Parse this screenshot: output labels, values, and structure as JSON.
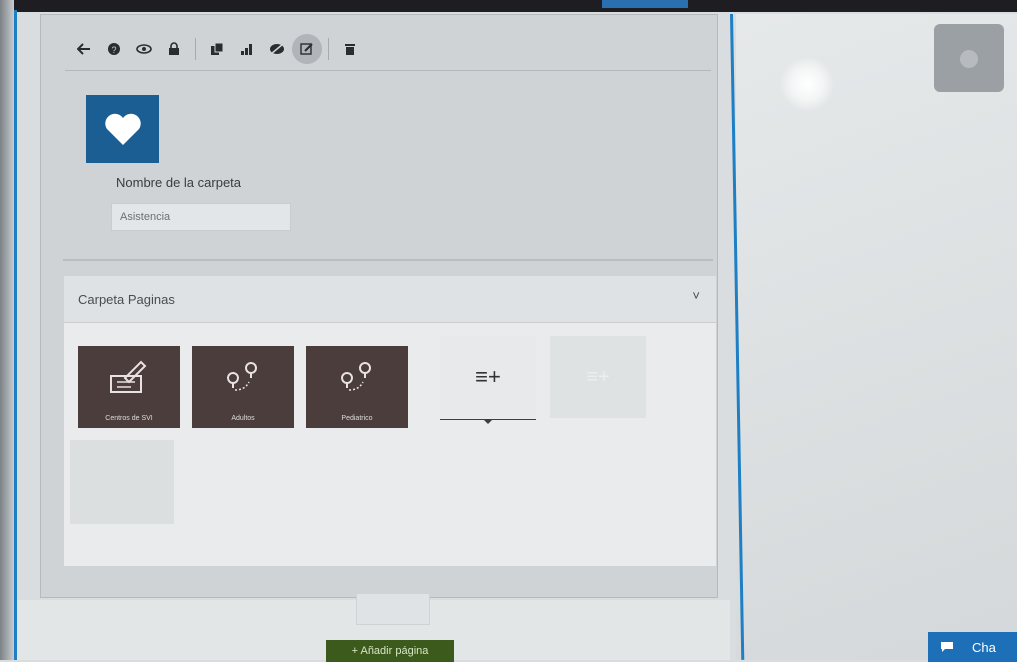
{
  "toolbar": {
    "icons": [
      "back-arrow-icon",
      "help-icon",
      "view-icon",
      "lock-icon",
      "copy-icon",
      "stats-icon",
      "hide-icon",
      "edit-icon",
      "delete-icon"
    ],
    "active": "edit-icon"
  },
  "folder": {
    "icon": "heart-icon",
    "icon_bg": "#1b5e93",
    "name_label": "Nombre de la carpeta",
    "name_value": "Asistencia"
  },
  "section": {
    "title": "Carpeta Paginas",
    "chevron": "˅"
  },
  "tiles": [
    {
      "label": "Centros de SVI",
      "icon": "signature-icon"
    },
    {
      "label": "Adultos",
      "icon": "route-pins-icon"
    },
    {
      "label": "Pediatrico",
      "icon": "route-pins-icon"
    }
  ],
  "add_tile": {
    "glyph": "≡+"
  },
  "ghost_tile": {
    "glyph": "≡+"
  },
  "buttons": {
    "add_page": "+ Añadir página",
    "chat": "Cha"
  },
  "colors": {
    "accent": "#1f7fc4",
    "tile": "#4a3d3b",
    "chat": "#1d6fb8",
    "add_page": "#3d5a1d"
  }
}
